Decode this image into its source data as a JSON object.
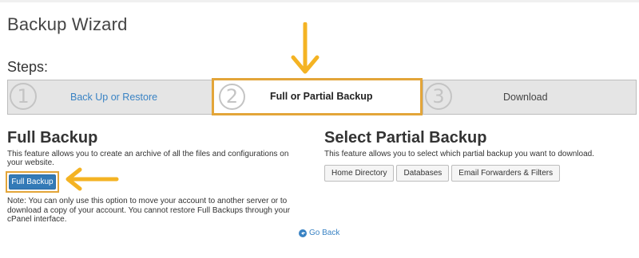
{
  "page": {
    "title": "Backup Wizard"
  },
  "steps": {
    "heading": "Steps:",
    "items": [
      {
        "number": "1",
        "label": "Back Up or Restore"
      },
      {
        "number": "2",
        "label": "Full or Partial Backup"
      },
      {
        "number": "3",
        "label": "Download"
      }
    ],
    "active_index": 1
  },
  "full_backup": {
    "title": "Full Backup",
    "description": "This feature allows you to create an archive of all the files and configurations on your website.",
    "button_label": "Full Backup",
    "note": "Note: You can only use this option to move your account to another server or to download a copy of your account. You cannot restore Full Backups through your cPanel interface."
  },
  "partial_backup": {
    "title": "Select Partial Backup",
    "description": "This feature allows you to select which partial backup you want to download.",
    "buttons": [
      "Home Directory",
      "Databases",
      "Email Forwarders & Filters"
    ]
  },
  "go_back": {
    "label": "Go Back",
    "icon": "arrow-circle-left-icon"
  },
  "colors": {
    "accent": "#3a83c4",
    "highlight": "#e3a539",
    "primary_button": "#337ab7"
  }
}
